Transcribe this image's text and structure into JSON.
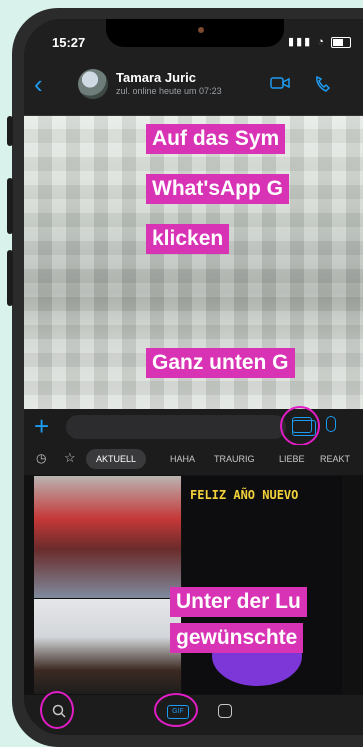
{
  "status": {
    "time": "15:27"
  },
  "header": {
    "name": "Tamara  Juric",
    "subtitle": "zul. online heute um 07:23"
  },
  "overlays": {
    "top_lines": [
      "Auf das Sym",
      "What'sApp G",
      "klicken"
    ],
    "middle": "Ganz unten G",
    "bottom_lines": [
      "Unter der Lu",
      "gewünschte"
    ]
  },
  "gif_tabs": {
    "active": "AKTUELL",
    "items": [
      "HAHA",
      "TRAURIG",
      "LIEBE",
      "REAKT"
    ]
  },
  "gif_preview": {
    "banner": "FELIZ AÑO NUEVO"
  },
  "bottom_bar": {
    "gif_label": "GIF"
  },
  "colors": {
    "accent": "#1d9bf0",
    "highlight": "#d832b5",
    "annotation_circle": "#e21cc6"
  },
  "icons": [
    "back-icon",
    "video-call-icon",
    "phone-icon",
    "plus-icon",
    "keyboard-icon",
    "camera-icon",
    "microphone-icon",
    "recent-icon",
    "favorite-star-icon",
    "search-icon",
    "gif-icon",
    "sticker-icon"
  ]
}
